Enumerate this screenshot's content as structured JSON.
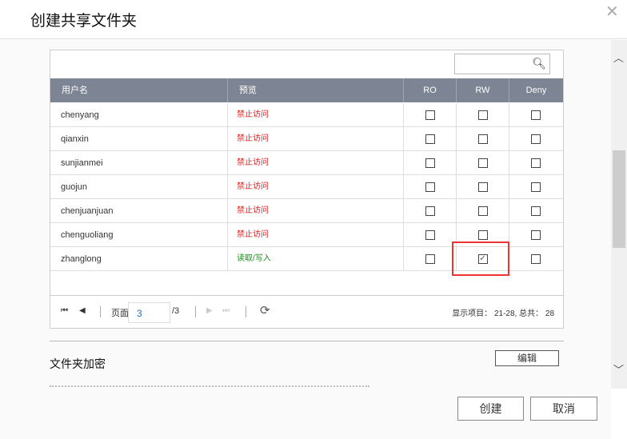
{
  "dialog": {
    "title": "创建共享文件夹",
    "close_icon": "close-icon"
  },
  "table": {
    "search_placeholder": "",
    "headers": [
      "用户名",
      "预览",
      "RO",
      "RW",
      "Deny"
    ],
    "rows": [
      {
        "user": "chenyang",
        "preview": "禁止访问",
        "status": "deny",
        "ro": false,
        "rw": false,
        "deny": false
      },
      {
        "user": "qianxin",
        "preview": "禁止访问",
        "status": "deny",
        "ro": false,
        "rw": false,
        "deny": false
      },
      {
        "user": "sunjianmei",
        "preview": "禁止访问",
        "status": "deny",
        "ro": false,
        "rw": false,
        "deny": false
      },
      {
        "user": "guojun",
        "preview": "禁止访问",
        "status": "deny",
        "ro": false,
        "rw": false,
        "deny": false
      },
      {
        "user": "chenjuanjuan",
        "preview": "禁止访问",
        "status": "deny",
        "ro": false,
        "rw": false,
        "deny": false
      },
      {
        "user": "chenguoliang",
        "preview": "禁止访问",
        "status": "deny",
        "ro": false,
        "rw": false,
        "deny": false
      },
      {
        "user": "zhanglong",
        "preview": "读取/写入",
        "status": "allow",
        "ro": false,
        "rw": true,
        "deny": false
      }
    ]
  },
  "pager": {
    "page_label": "页面",
    "page": "3",
    "total_pages": "/3",
    "summary": "显示项目： 21-28, 总共： 28"
  },
  "encryption": {
    "title": "文件夹加密",
    "edit": "编辑"
  },
  "footer": {
    "create": "创建",
    "cancel": "取消"
  },
  "colors": {
    "header": "#7d8594",
    "deny": "#dd2222",
    "allow": "#1a8a1a",
    "highlight": "#ee3333"
  }
}
